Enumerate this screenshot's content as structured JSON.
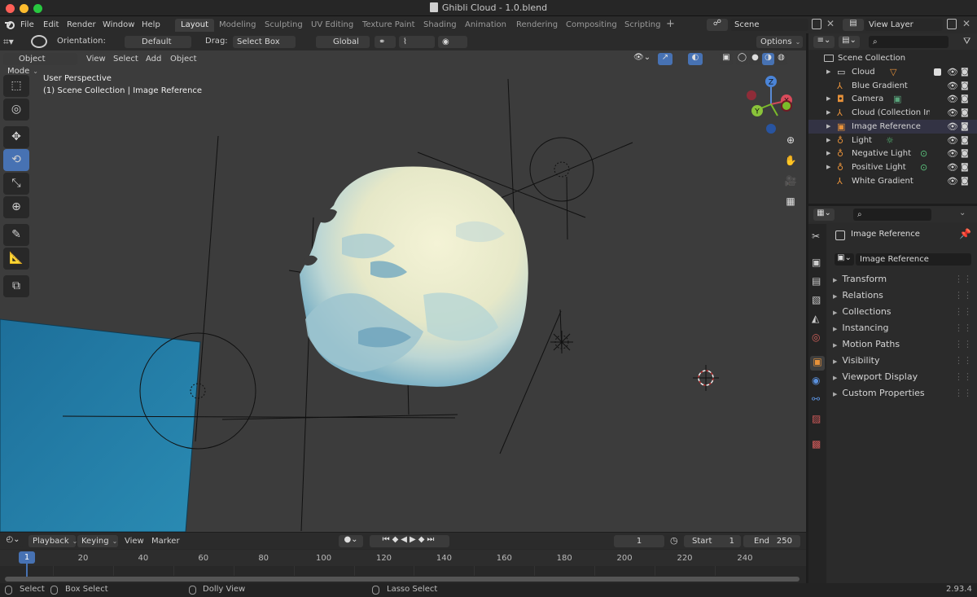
{
  "window": {
    "title": "Ghibli Cloud - 1.0.blend"
  },
  "menu": [
    "File",
    "Edit",
    "Render",
    "Window",
    "Help"
  ],
  "workspaces": [
    "Layout",
    "Modeling",
    "Sculpting",
    "UV Editing",
    "Texture Paint",
    "Shading",
    "Animation",
    "Rendering",
    "Compositing",
    "Scripting"
  ],
  "active_workspace": "Layout",
  "scene": {
    "name": "Scene",
    "view_layer": "View Layer"
  },
  "tool_header": {
    "orientation_label": "Orientation:",
    "orientation_value": "Default",
    "drag_label": "Drag:",
    "drag_value": "Select Box",
    "transform_orientation": "Global",
    "options": "Options"
  },
  "viewport_header": {
    "mode": "Object Mode",
    "menus": [
      "View",
      "Select",
      "Add",
      "Object"
    ]
  },
  "viewport": {
    "perspective": "User Perspective",
    "context": "(1) Scene Collection | Image Reference"
  },
  "gizmo": {
    "z": "Z",
    "y": "Y",
    "x": "X"
  },
  "outliner": {
    "search_placeholder": "",
    "root": "Scene Collection",
    "items": [
      {
        "label": "Cloud",
        "icon": "collection-icon",
        "extra": "mesh-icon",
        "expand": true
      },
      {
        "label": "Blue Gradient",
        "icon": "empty-axes-icon",
        "expand": false
      },
      {
        "label": "Camera",
        "icon": "camera-object-icon",
        "extra": "camera-data-icon",
        "expand": true
      },
      {
        "label": "Cloud (Collection Insta",
        "icon": "empty-axes-icon",
        "expand": true
      },
      {
        "label": "Image Reference",
        "icon": "image-empty-icon",
        "expand": true
      },
      {
        "label": "Light",
        "icon": "light-object-icon",
        "extra": "sun-light-icon",
        "expand": true
      },
      {
        "label": "Negative Light",
        "icon": "light-object-icon",
        "extra": "light-data-icon",
        "expand": true
      },
      {
        "label": "Positive Light",
        "icon": "light-object-icon",
        "extra": "light-data-icon",
        "expand": true
      },
      {
        "label": "White Gradient",
        "icon": "empty-axes-icon",
        "expand": false
      }
    ]
  },
  "properties": {
    "object_name": "Image Reference",
    "datablock": "Image Reference",
    "panels": [
      "Transform",
      "Relations",
      "Collections",
      "Instancing",
      "Motion Paths",
      "Visibility",
      "Viewport Display",
      "Custom Properties"
    ]
  },
  "timeline": {
    "menus": [
      "Playback",
      "Keying",
      "View",
      "Marker"
    ],
    "current_frame": "1",
    "start_label": "Start",
    "start": "1",
    "end_label": "End",
    "end": "250",
    "ticks": [
      "20",
      "40",
      "60",
      "80",
      "100",
      "120",
      "140",
      "160",
      "180",
      "200",
      "220",
      "240"
    ],
    "playhead": "1"
  },
  "statusbar": {
    "items": [
      "Select",
      "Box Select",
      "Dolly View",
      "Lasso Select"
    ],
    "version": "2.93.4"
  },
  "colors": {
    "accent": "#4772b3",
    "active_object": "#e89a3a",
    "background": "#3c3c3c"
  }
}
